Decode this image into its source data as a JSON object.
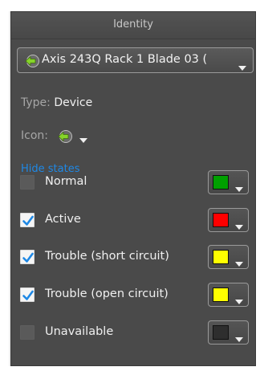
{
  "panel": {
    "title": "Identity"
  },
  "entity_selector": {
    "label": "Axis 243Q Rack 1 Blade 03 (",
    "icon": "device-arrow-icon"
  },
  "type_row": {
    "label": "Type:",
    "value": "Device"
  },
  "icon_row": {
    "label": "Icon:",
    "icon": "device-arrow-icon"
  },
  "hide_states_link": "Hide states",
  "states": [
    {
      "label": "Normal",
      "checked": false,
      "color": "#00a000"
    },
    {
      "label": "Active",
      "checked": true,
      "color": "#ff0000"
    },
    {
      "label": "Trouble (short circuit)",
      "checked": true,
      "color": "#ffff00"
    },
    {
      "label": "Trouble (open circuit)",
      "checked": true,
      "color": "#ffff00"
    },
    {
      "label": "Unavailable",
      "checked": false,
      "color": "#2e2e2e"
    }
  ],
  "colors": {
    "panel_bg": "#4a4a4a",
    "link": "#1e88e5",
    "icon_green": "#7ed321"
  }
}
